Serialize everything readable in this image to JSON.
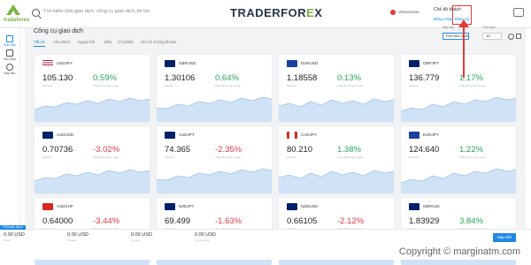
{
  "topbar": {
    "brand_main": "TRADERFOR",
    "brand_x": "E",
    "brand_tail": "X",
    "logo_text": "tradeforex",
    "search_placeholder": "Tìm kiếm nhà giao dịch, công cụ giao dịch, tin tức",
    "language": "Vietnamese",
    "account_title": "Chế độ khách",
    "login_label": "Đăng nhập",
    "register_label": "Đăng ký"
  },
  "sidebar": {
    "items": [
      {
        "label": "Giao dịch",
        "icon": "chart-icon",
        "active": true
      },
      {
        "label": "Sao chép",
        "icon": "copy-icon",
        "active": false
      },
      {
        "label": "Nạp tiền",
        "icon": "dollar-icon",
        "active": false
      }
    ]
  },
  "main": {
    "title": "Công cụ giao dịch",
    "tabs": [
      "Tất cả",
      "Yêu thích",
      "Ngoại hối",
      "Dầu",
      "Cổ phiếu",
      "Chỉ số chứng khoán"
    ],
    "sort_label": "Sắp xếp",
    "sort_value": "Phổ biến nhất",
    "period_label": "Thời gian",
    "period_value": "1D"
  },
  "cards": [
    {
      "symbol": "USDJPY",
      "price": "105.130",
      "change": "0.59%",
      "dir": "up",
      "flag": "us"
    },
    {
      "symbol": "GBPUSD",
      "price": "1.30106",
      "change": "0.64%",
      "dir": "up",
      "flag": "gb"
    },
    {
      "symbol": "EURUSD",
      "price": "1.18558",
      "change": "0.13%",
      "dir": "up",
      "flag": "eu"
    },
    {
      "symbol": "GBPJPY",
      "price": "136.779",
      "change": "1.17%",
      "dir": "up",
      "flag": "gb"
    },
    {
      "symbol": "AUDUSD",
      "price": "0.70736",
      "change": "-3.02%",
      "dir": "down",
      "flag": "au"
    },
    {
      "symbol": "AUDJPY",
      "price": "74.365",
      "change": "-2.35%",
      "dir": "down",
      "flag": "au"
    },
    {
      "symbol": "CADJPY",
      "price": "80.210",
      "change": "1.38%",
      "dir": "up",
      "flag": "ca"
    },
    {
      "symbol": "EURJPY",
      "price": "124.640",
      "change": "1.22%",
      "dir": "up",
      "flag": "eu"
    },
    {
      "symbol": "AUDCHF",
      "price": "0.64000",
      "change": "-3.44%",
      "dir": "down",
      "flag": "ch"
    },
    {
      "symbol": "NZDJPY",
      "price": "69.499",
      "change": "-1.63%",
      "dir": "down",
      "flag": "nz"
    },
    {
      "symbol": "NZDUSD",
      "price": "0.66105",
      "change": "-2.12%",
      "dir": "down",
      "flag": "nz"
    },
    {
      "symbol": "GBPAUD",
      "price": "1.83929",
      "change": "3.84%",
      "dir": "up",
      "flag": "gb"
    }
  ],
  "card_labels": {
    "price_label": "Giá bán",
    "change_label": "Thay đổi trong 1 ngày"
  },
  "bottombar": {
    "badge": "Tài khoản demo",
    "balances": [
      {
        "value": "0.00 USD",
        "label": "Số dư"
      },
      {
        "value": "0.00 USD",
        "label": "Tài sản"
      },
      {
        "value": "0.00 USD",
        "label": "Ký quỹ"
      },
      {
        "value": "0.00 USD",
        "label": "Ký quỹ tự do"
      }
    ],
    "deposit_label": "Nạp tiền"
  },
  "watermark": "Copyright © marginatm.com",
  "colors": {
    "accent": "#1e88e5",
    "up": "#26a65b",
    "down": "#e53945",
    "annotation": "#e53935"
  }
}
